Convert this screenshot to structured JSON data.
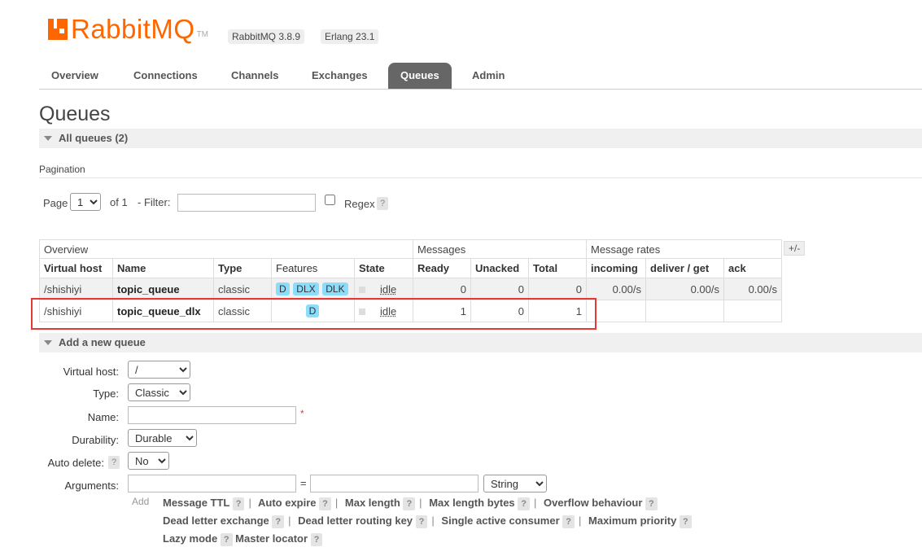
{
  "header": {
    "logo_text": "RabbitMQ",
    "logo_tm": "TM",
    "version": "RabbitMQ 3.8.9",
    "erlang": "Erlang 23.1"
  },
  "tabs": [
    {
      "label": "Overview"
    },
    {
      "label": "Connections"
    },
    {
      "label": "Channels"
    },
    {
      "label": "Exchanges"
    },
    {
      "label": "Queues"
    },
    {
      "label": "Admin"
    }
  ],
  "page_title": "Queues",
  "all_queues_header": "All queues (2)",
  "pagination": {
    "title": "Pagination",
    "page_label": "Page",
    "page_value": "1",
    "of_label": "of 1",
    "filter_label": "- Filter:",
    "filter_value": "",
    "regex_label": "Regex",
    "help": "?"
  },
  "table": {
    "group_headers": {
      "overview": "Overview",
      "messages": "Messages",
      "message_rates": "Message rates"
    },
    "plus_minus": "+/-",
    "columns": {
      "vhost": "Virtual host",
      "name": "Name",
      "type": "Type",
      "features": "Features",
      "state": "State",
      "ready": "Ready",
      "unacked": "Unacked",
      "total": "Total",
      "incoming": "incoming",
      "deliver_get": "deliver / get",
      "ack": "ack"
    },
    "rows": [
      {
        "vhost": "/shishiyi",
        "name": "topic_queue",
        "type": "classic",
        "features": [
          "D",
          "DLX",
          "DLK"
        ],
        "state": "idle",
        "ready": "0",
        "unacked": "0",
        "total": "0",
        "incoming": "0.00/s",
        "deliver_get": "0.00/s",
        "ack": "0.00/s"
      },
      {
        "vhost": "/shishiyi",
        "name": "topic_queue_dlx",
        "type": "classic",
        "features": [
          "D"
        ],
        "state": "idle",
        "ready": "1",
        "unacked": "0",
        "total": "1",
        "incoming": "",
        "deliver_get": "",
        "ack": ""
      }
    ]
  },
  "add_queue": {
    "header": "Add a new queue",
    "virtual_host_label": "Virtual host:",
    "virtual_host_value": "/",
    "type_label": "Type:",
    "type_value": "Classic",
    "name_label": "Name:",
    "name_value": "",
    "required_mark": "*",
    "durability_label": "Durability:",
    "durability_value": "Durable",
    "auto_delete_label": "Auto delete:",
    "auto_delete_value": "No",
    "arguments_label": "Arguments:",
    "equals": "=",
    "arg_type_value": "String",
    "add_label": "Add",
    "help": "?",
    "arg_links_row1": [
      "Message TTL",
      "Auto expire",
      "Max length",
      "Max length bytes",
      "Overflow behaviour"
    ],
    "arg_links_row2": [
      "Dead letter exchange",
      "Dead letter routing key",
      "Single active consumer",
      "Maximum priority"
    ],
    "arg_links_row3": [
      "Lazy mode",
      "Master locator"
    ]
  }
}
